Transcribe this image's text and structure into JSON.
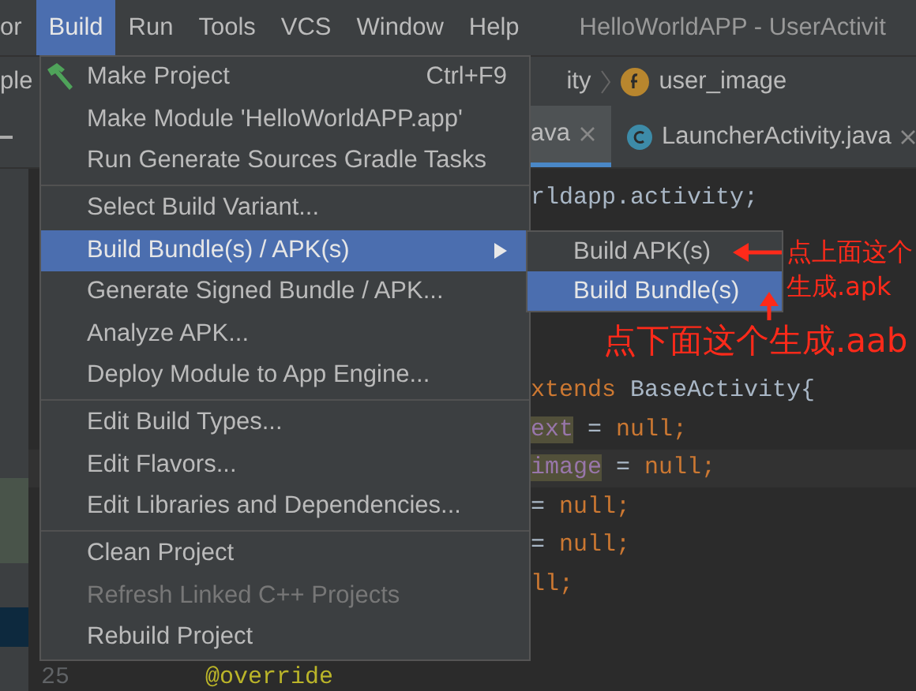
{
  "menubar": {
    "items": [
      {
        "label": "or",
        "selected": false
      },
      {
        "label": "Build",
        "selected": true
      },
      {
        "label": "Run",
        "selected": false
      },
      {
        "label": "Tools",
        "selected": false
      },
      {
        "label": "VCS",
        "selected": false
      },
      {
        "label": "Window",
        "selected": false
      },
      {
        "label": "Help",
        "selected": false
      }
    ],
    "title": "HelloWorldAPP - UserActivit"
  },
  "breadcrumbs": [
    {
      "label": "ple",
      "kind": "text"
    },
    {
      "label": "ity",
      "kind": "text"
    },
    {
      "label": "user_image",
      "kind": "field"
    }
  ],
  "tabs": [
    {
      "label": "ava",
      "selected": true
    },
    {
      "label": "LauncherActivity.java",
      "selected": false
    }
  ],
  "editor": {
    "lines": [
      {
        "kind": "behind_menu",
        "segments": [
          {
            "text": "rldapp.activity;",
            "kind": "plain"
          }
        ]
      },
      {
        "kind": "empty"
      },
      {
        "kind": "empty"
      },
      {
        "kind": "empty"
      },
      {
        "kind": "empty"
      },
      {
        "kind": "behind_menu",
        "segments": [
          {
            "text": "xtends ",
            "kind": "keyword"
          },
          {
            "text": "BaseActivity{",
            "kind": "plain"
          }
        ]
      },
      {
        "kind": "behind_menu",
        "segments": [
          {
            "text": "ext",
            "kind": "field",
            "highlight": true
          },
          {
            "text": " = ",
            "kind": "plain"
          },
          {
            "text": "null;",
            "kind": "keyword"
          }
        ]
      },
      {
        "kind": "behind_menu",
        "current": true,
        "segments": [
          {
            "text": "image",
            "kind": "field",
            "highlight": true
          },
          {
            "text": " = ",
            "kind": "plain"
          },
          {
            "text": "null;",
            "kind": "keyword"
          }
        ]
      },
      {
        "kind": "behind_menu",
        "segments": [
          {
            "text": "= ",
            "kind": "plain"
          },
          {
            "text": "null;",
            "kind": "keyword"
          }
        ]
      },
      {
        "kind": "behind_menu",
        "segments": [
          {
            "text": "= ",
            "kind": "plain"
          },
          {
            "text": "null;",
            "kind": "keyword"
          }
        ]
      },
      {
        "kind": "behind_menu",
        "segments": [
          {
            "text": "ll;",
            "kind": "keyword"
          }
        ]
      },
      {
        "kind": "empty"
      },
      {
        "kind": "full",
        "number": "25",
        "segments": [
          {
            "text": "@override",
            "kind": "annotation"
          }
        ]
      }
    ]
  },
  "menu": {
    "items": [
      {
        "kind": "item",
        "label": "Make Project",
        "shortcut": "Ctrl+F9",
        "has_icon": true,
        "selected": false,
        "disabled": false
      },
      {
        "kind": "item",
        "label": "Make Module 'HelloWorldAPP.app'",
        "selected": false,
        "disabled": false
      },
      {
        "kind": "item",
        "label": "Run Generate Sources Gradle Tasks",
        "selected": false,
        "disabled": false
      },
      {
        "kind": "separator"
      },
      {
        "kind": "item",
        "label": "Select Build Variant...",
        "selected": false,
        "disabled": false
      },
      {
        "kind": "item",
        "label": "Build Bundle(s) / APK(s)",
        "has_submenu": true,
        "selected": true,
        "disabled": false
      },
      {
        "kind": "item",
        "label": "Generate Signed Bundle / APK...",
        "selected": false,
        "disabled": false
      },
      {
        "kind": "item",
        "label": "Analyze APK...",
        "selected": false,
        "disabled": false
      },
      {
        "kind": "item",
        "label": "Deploy Module to App Engine...",
        "selected": false,
        "disabled": false
      },
      {
        "kind": "separator"
      },
      {
        "kind": "item",
        "label": "Edit Build Types...",
        "selected": false,
        "disabled": false
      },
      {
        "kind": "item",
        "label": "Edit Flavors...",
        "selected": false,
        "disabled": false
      },
      {
        "kind": "item",
        "label": "Edit Libraries and Dependencies...",
        "selected": false,
        "disabled": false
      },
      {
        "kind": "separator"
      },
      {
        "kind": "item",
        "label": "Clean Project",
        "selected": false,
        "disabled": false
      },
      {
        "kind": "item",
        "label": "Refresh Linked C++ Projects",
        "selected": false,
        "disabled": true
      },
      {
        "kind": "item",
        "label": "Rebuild Project",
        "selected": false,
        "disabled": false
      }
    ]
  },
  "submenu": {
    "items": [
      {
        "label": "Build APK(s)",
        "selected": false
      },
      {
        "label": "Build Bundle(s)",
        "selected": true
      }
    ]
  },
  "annotations": [
    {
      "text": "点上面这个生成.apk"
    },
    {
      "text": "点下面这个生成.aab"
    }
  ]
}
